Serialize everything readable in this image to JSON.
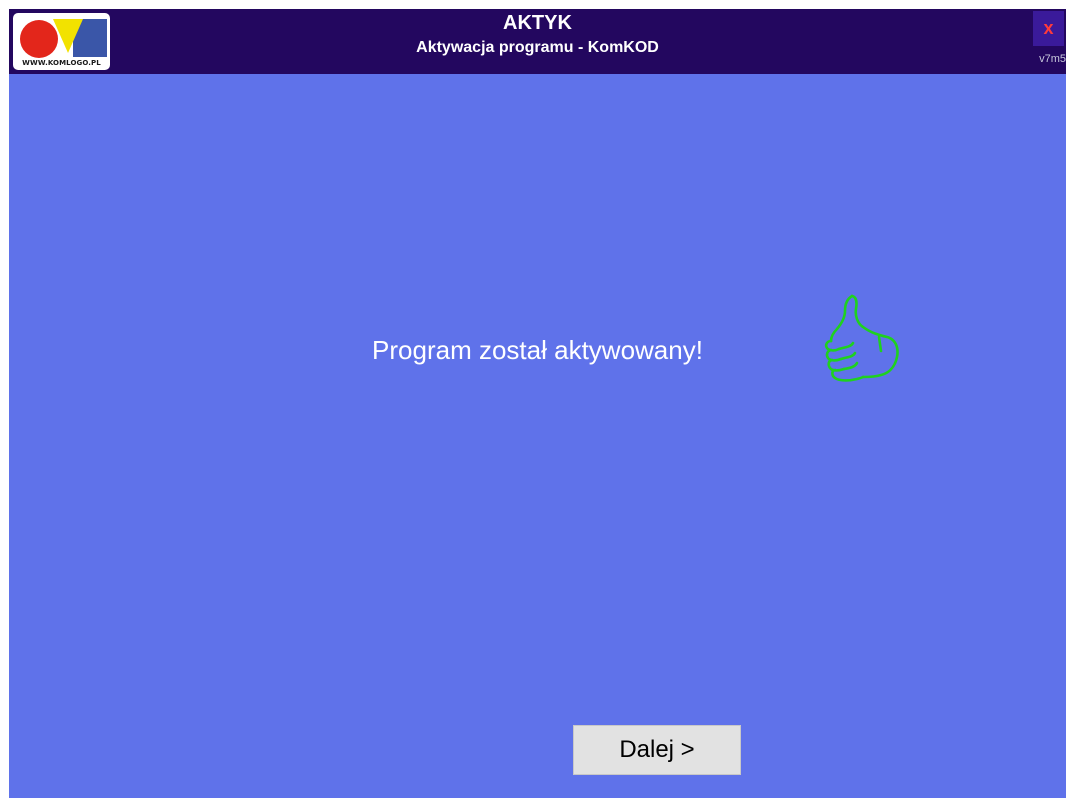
{
  "titlebar": {
    "logo_text": "WWW.KOMLOGO.PL",
    "title": "AKTYK",
    "subtitle": "Aktywacja programu - KomKOD",
    "close_label": "x",
    "version": "v7m5"
  },
  "main": {
    "message": "Program został aktywowany!",
    "status_icon": "thumbs-up-icon"
  },
  "footer": {
    "next_label": "Dalej >"
  },
  "colors": {
    "titlebar_bg": "#23075f",
    "content_bg": "#5f72ea",
    "icon_green": "#1fd11f",
    "close_red": "#ff3b3b"
  }
}
